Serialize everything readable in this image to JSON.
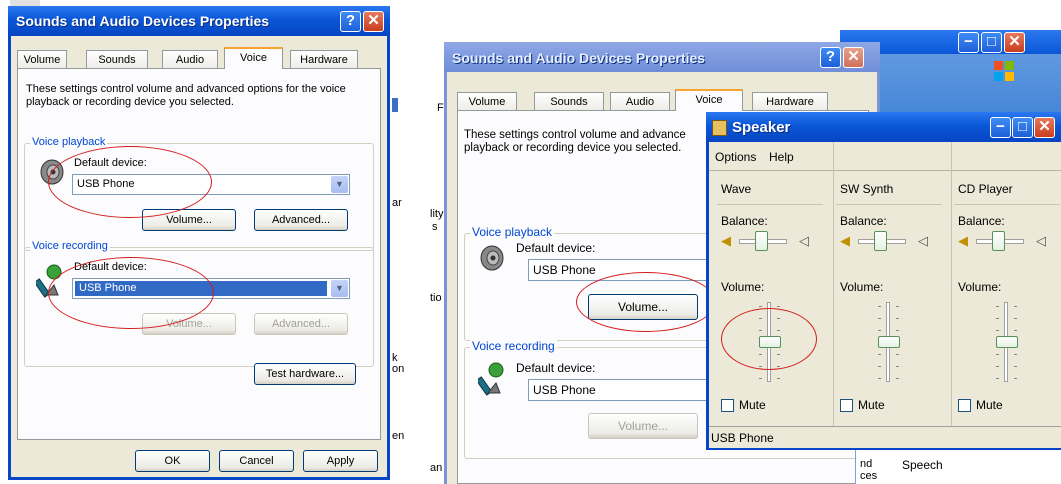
{
  "left_dialog": {
    "title": "Sounds and Audio Devices Properties",
    "help_btn": "?",
    "close_btn": "✕",
    "tabs": [
      "Volume",
      "Sounds",
      "Audio",
      "Voice",
      "Hardware"
    ],
    "description": "These settings control volume and advanced options for the voice playback or recording device you selected.",
    "playback": {
      "group_label": "Voice playback",
      "device_label": "Default device:",
      "device_value": "USB Phone",
      "volume_btn": "Volume...",
      "advanced_btn": "Advanced..."
    },
    "recording": {
      "group_label": "Voice recording",
      "device_label": "Default device:",
      "device_value": "USB Phone",
      "volume_btn": "Volume...",
      "advanced_btn": "Advanced..."
    },
    "test_hardware_btn": "Test hardware...",
    "ok_btn": "OK",
    "cancel_btn": "Cancel",
    "apply_btn": "Apply"
  },
  "right_dialog": {
    "title": "Sounds and Audio Devices Properties",
    "help_btn": "?",
    "close_btn": "✕",
    "tabs": [
      "Volume",
      "Sounds",
      "Audio",
      "Voice",
      "Hardware"
    ],
    "description": "These settings control volume and advance playback or recording device you selected.",
    "playback": {
      "group_label": "Voice playback",
      "device_label": "Default device:",
      "device_value": "USB Phone",
      "volume_btn": "Volume..."
    },
    "recording": {
      "group_label": "Voice recording",
      "device_label": "Default device:",
      "device_value": "USB Phone",
      "volume_btn": "Volume..."
    }
  },
  "speaker": {
    "title": "Speaker",
    "menu": [
      "Options",
      "Help"
    ],
    "channels": [
      {
        "name": "Wave",
        "balance_label": "Balance:",
        "volume_label": "Volume:",
        "mute_label": "Mute",
        "level": 0.5
      },
      {
        "name": "SW Synth",
        "balance_label": "Balance:",
        "volume_label": "Volume:",
        "mute_label": "Mute",
        "level": 0.5
      },
      {
        "name": "CD Player",
        "balance_label": "Balance:",
        "volume_label": "Volume:",
        "mute_label": "Mute",
        "level": 0.5
      }
    ],
    "status": "USB Phone"
  },
  "background": {
    "fragments": [
      "F",
      "lity",
      "s",
      "tio",
      "ar",
      "k",
      "on",
      "en",
      "an",
      "nd",
      "ces",
      "Speech",
      "≔"
    ]
  },
  "colors": {
    "title_blue": "#0a56d8",
    "dialog_bg": "#ece9d8",
    "group_label": "#0046d5",
    "annotation_red": "#d41c1c",
    "selection": "#316ac5"
  }
}
